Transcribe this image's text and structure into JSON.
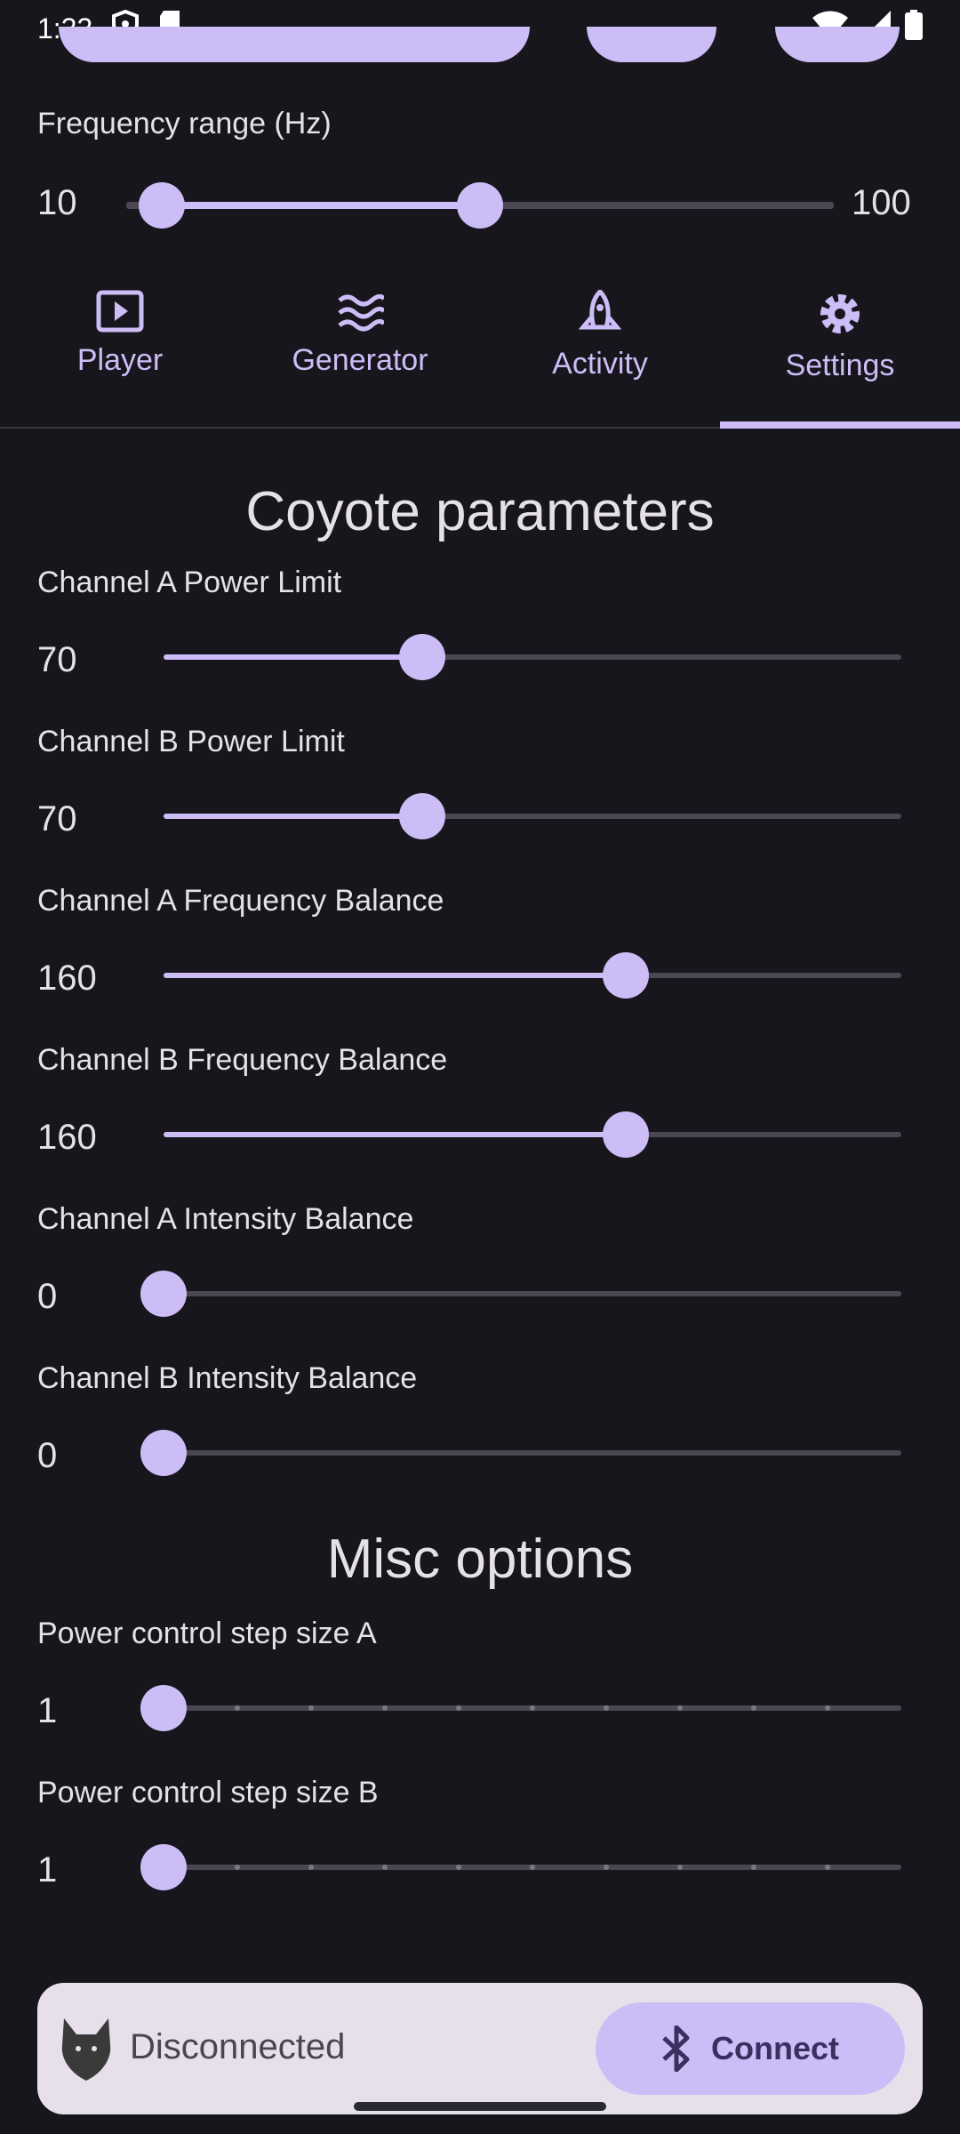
{
  "status_bar": {
    "time": "1:33"
  },
  "frequency_range": {
    "label": "Frequency range (Hz)",
    "min_value": "10",
    "max_value": "100",
    "low_fraction": 0.0,
    "high_fraction": 0.45
  },
  "tabs": [
    {
      "label": "Player",
      "icon": "play-icon"
    },
    {
      "label": "Generator",
      "icon": "waves-icon"
    },
    {
      "label": "Activity",
      "icon": "rocket-icon"
    },
    {
      "label": "Settings",
      "icon": "gear-icon",
      "selected": true
    }
  ],
  "coyote": {
    "title": "Coyote parameters",
    "sliders": [
      {
        "label": "Channel A Power Limit",
        "value": "70",
        "fraction": 0.35
      },
      {
        "label": "Channel B Power Limit",
        "value": "70",
        "fraction": 0.35
      },
      {
        "label": "Channel A Frequency Balance",
        "value": "160",
        "fraction": 0.627
      },
      {
        "label": "Channel B Frequency Balance",
        "value": "160",
        "fraction": 0.627
      },
      {
        "label": "Channel A Intensity Balance",
        "value": "0",
        "fraction": 0.0
      },
      {
        "label": "Channel B Intensity Balance",
        "value": "0",
        "fraction": 0.0
      }
    ]
  },
  "misc": {
    "title": "Misc options",
    "sliders": [
      {
        "label": "Power control step size A",
        "value": "1",
        "fraction": 0.0,
        "steps": 10
      },
      {
        "label": "Power control step size B",
        "value": "1",
        "fraction": 0.0,
        "steps": 10
      }
    ]
  },
  "bottom": {
    "status": "Disconnected",
    "connect_label": "Connect",
    "icon": "bluetooth-icon"
  },
  "colors": {
    "accent": "#cdbdf7",
    "background": "#17161c",
    "track": "#4a4752"
  }
}
